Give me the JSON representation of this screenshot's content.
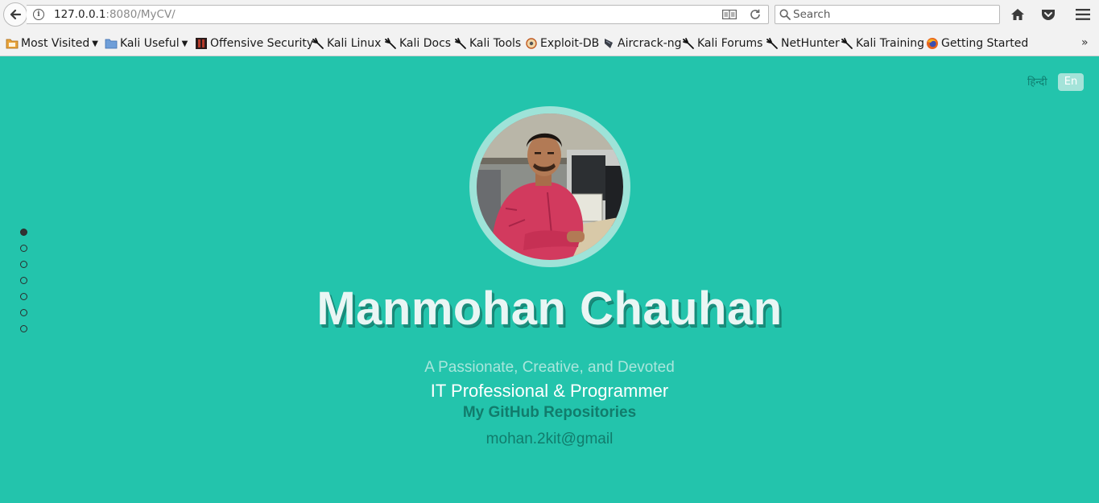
{
  "browser": {
    "url_host": "127.0.0.1",
    "url_path": ":8080/MyCV/",
    "search_placeholder": "Search"
  },
  "bookmarks": {
    "most_visited": "Most Visited",
    "kali_useful": "Kali Useful",
    "offensive_security": "Offensive Security",
    "kali_linux": "Kali Linux",
    "kali_docs": "Kali Docs",
    "kali_tools": "Kali Tools",
    "exploit_db": "Exploit-DB",
    "aircrack": "Aircrack-ng",
    "kali_forums": "Kali Forums",
    "nethunter": "NetHunter",
    "kali_training": "Kali Training",
    "getting_started": "Getting Started",
    "overflow": "»"
  },
  "languages": {
    "hindi": "हिन्दी",
    "english": "En"
  },
  "profile": {
    "name": "Manmohan Chauhan",
    "tagline": "A Passionate, Creative, and Devoted",
    "profession": "IT Professional & Programmer",
    "github": "My GitHub Repositories",
    "email": "mohan.2kit@gmail"
  },
  "section_nav": {
    "total": 7,
    "active": 1
  },
  "colors": {
    "background": "#23c4ac",
    "ring": "#9ee3d8",
    "link": "#117c6c"
  }
}
